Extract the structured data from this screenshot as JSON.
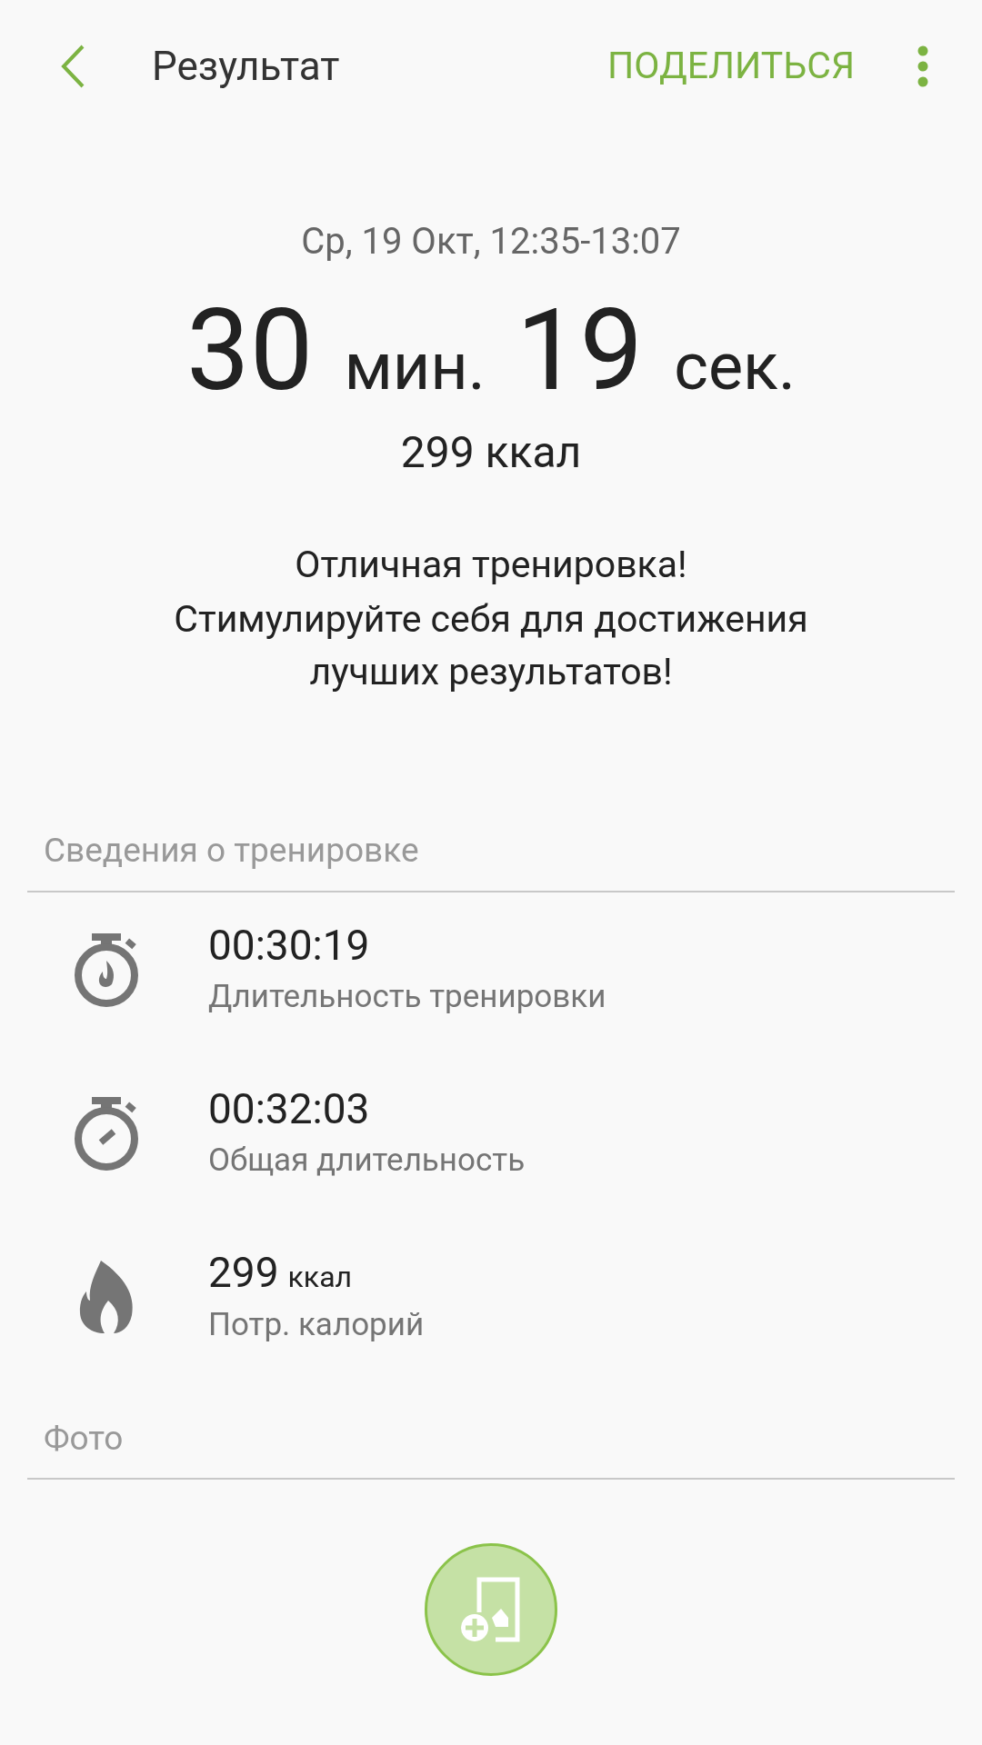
{
  "header": {
    "title": "Результат",
    "action": "ПОДЕЛИТЬСЯ"
  },
  "summary": {
    "date": "Ср, 19 Окт, 12:35-13:07",
    "duration": [
      {
        "value": "30",
        "unit": "мин."
      },
      {
        "value": "19",
        "unit": "сек."
      }
    ],
    "calories": "299 ккал",
    "praise": "Отличная тренировка!",
    "advice": "Стимулируйте себя для достижения лучших результатов!"
  },
  "details": {
    "title": "Сведения о тренировке",
    "items": [
      {
        "kind": "workout-time",
        "value": "00:30:19",
        "label": "Длительность тренировки"
      },
      {
        "kind": "total-time",
        "value": "00:32:03",
        "label": "Общая длительность"
      },
      {
        "kind": "calories",
        "value": "299",
        "unit": "ккал",
        "label": "Потр. калорий"
      }
    ]
  },
  "photo": {
    "title": "Фото"
  }
}
